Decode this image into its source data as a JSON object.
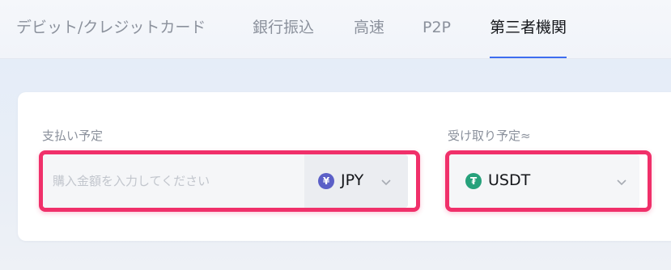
{
  "tabs": [
    {
      "label": "デビット/クレジットカード"
    },
    {
      "label": "銀行振込"
    },
    {
      "label": "高速"
    },
    {
      "label": "P2P"
    },
    {
      "label": "第三者機関"
    }
  ],
  "active_tab": "第三者機関",
  "pay": {
    "label": "支払い予定",
    "placeholder": "購入金額を入力してください",
    "currency": "JPY",
    "currency_symbol": "¥",
    "currency_icon": "yen-coin-icon"
  },
  "receive": {
    "label": "受け取り予定≈",
    "currency": "USDT",
    "currency_symbol": "₮",
    "currency_icon": "tether-coin-icon"
  },
  "colors": {
    "accent": "#3e6df0",
    "highlight": "#f0306a",
    "jpy_coin": "#5b5fc7",
    "usdt_coin": "#26a17b"
  }
}
